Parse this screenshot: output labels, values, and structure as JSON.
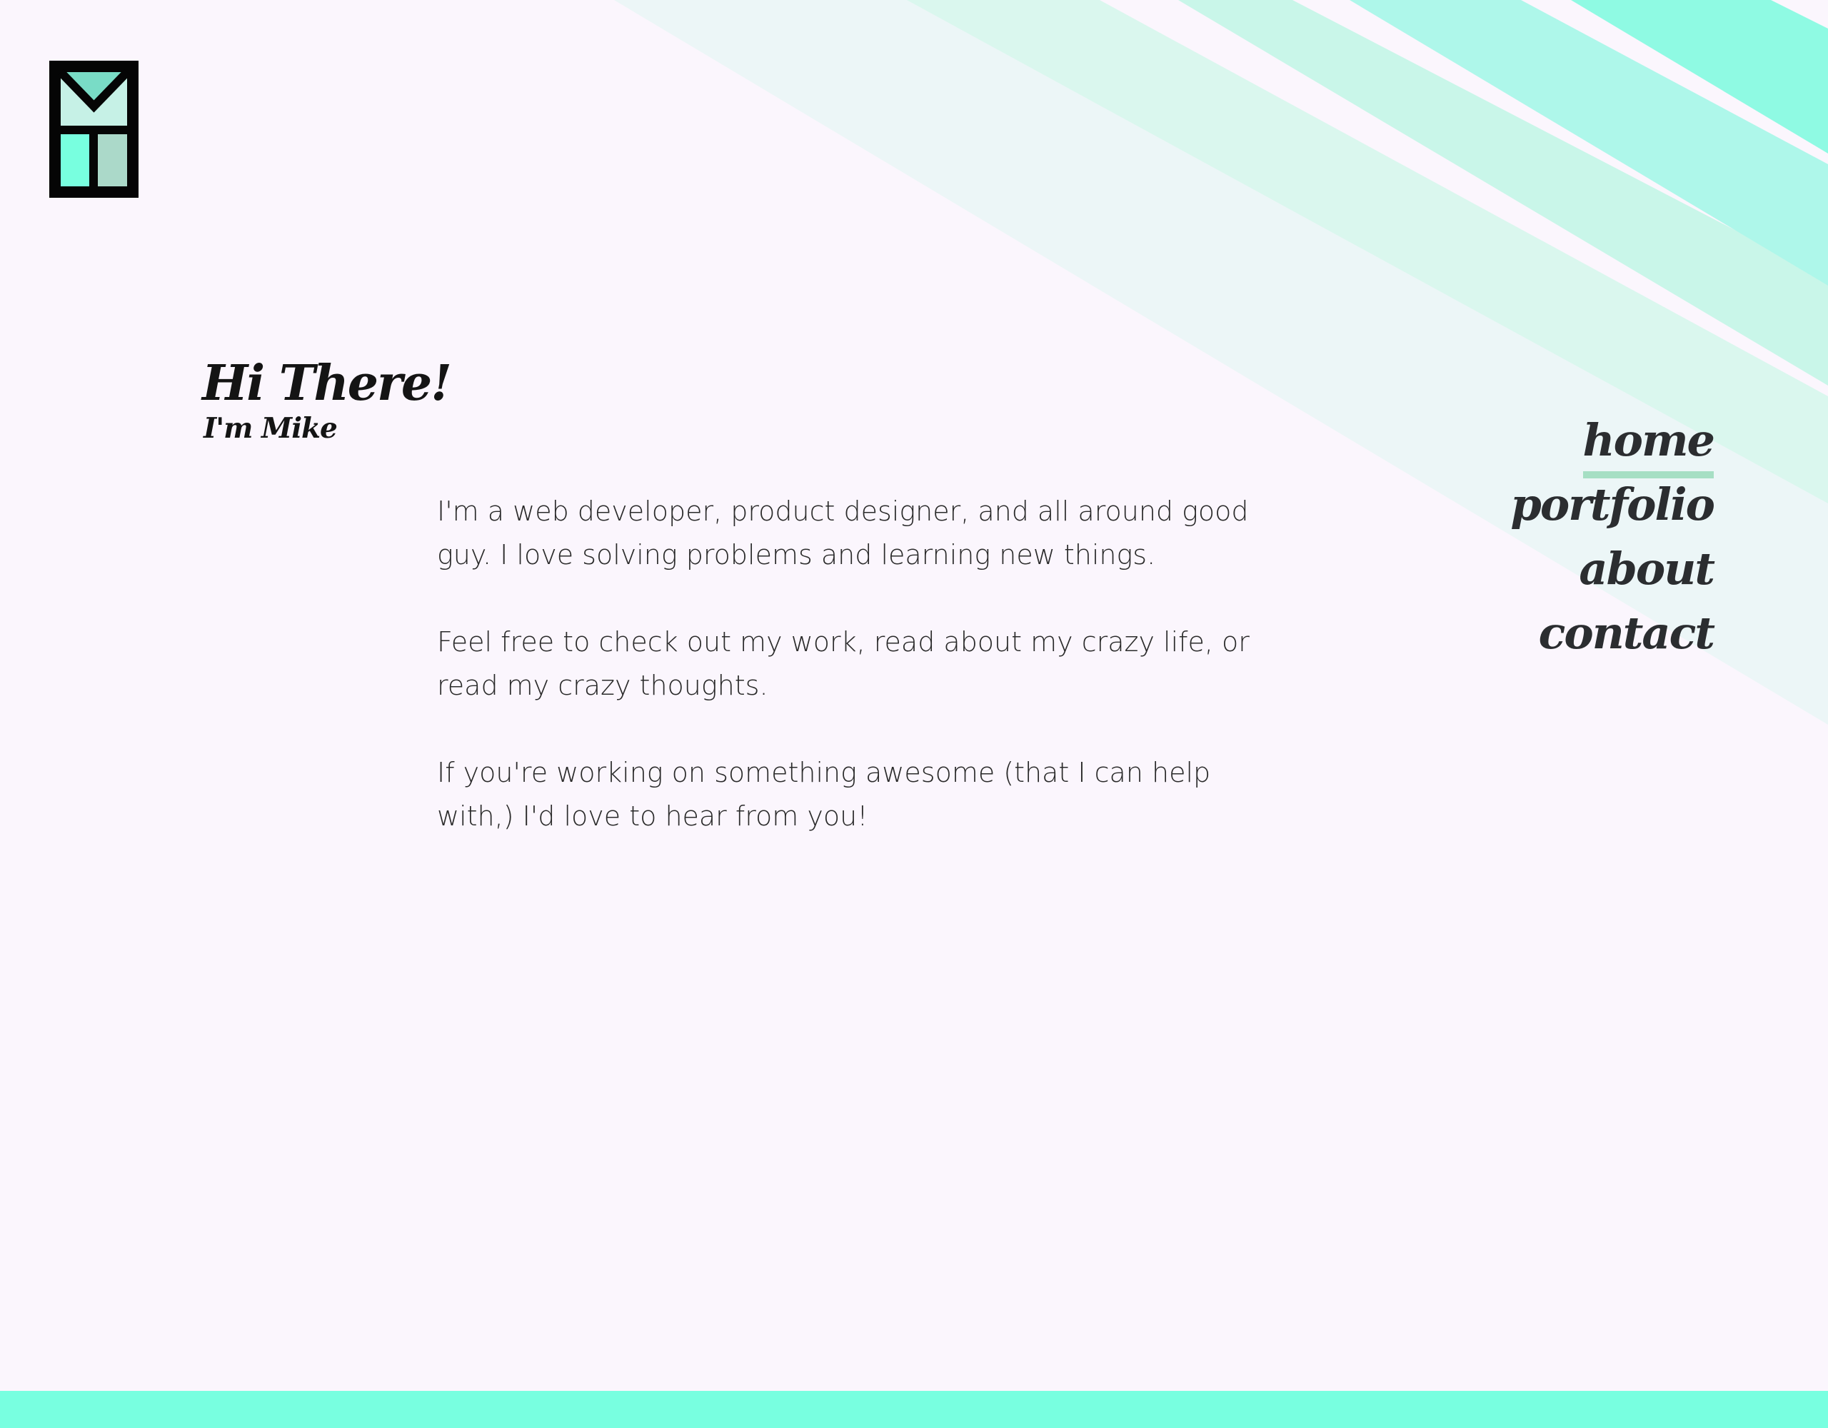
{
  "header": {
    "logo_icon": "mh-monogram-logo"
  },
  "intro": {
    "greeting": "Hi There!",
    "subgreeting": "I'm Mike"
  },
  "bio": {
    "paragraphs": [
      "I'm a web developer, product designer, and all around good guy. I love solving problems and learning new things.",
      "Feel free to check out my work, read about my crazy life, or read my crazy thoughts.",
      "If you're working on something awesome (that I can help with,) I'd love to hear from you!"
    ]
  },
  "nav": {
    "items": [
      {
        "label": "home",
        "active": true
      },
      {
        "label": "portfolio",
        "active": false
      },
      {
        "label": "about",
        "active": false
      },
      {
        "label": "contact",
        "active": false
      }
    ]
  },
  "colors": {
    "background": "#fbf6fd",
    "accent": "#78ffe0",
    "nav_underline": "#a6dfc4",
    "text": "#1e1e1e"
  }
}
